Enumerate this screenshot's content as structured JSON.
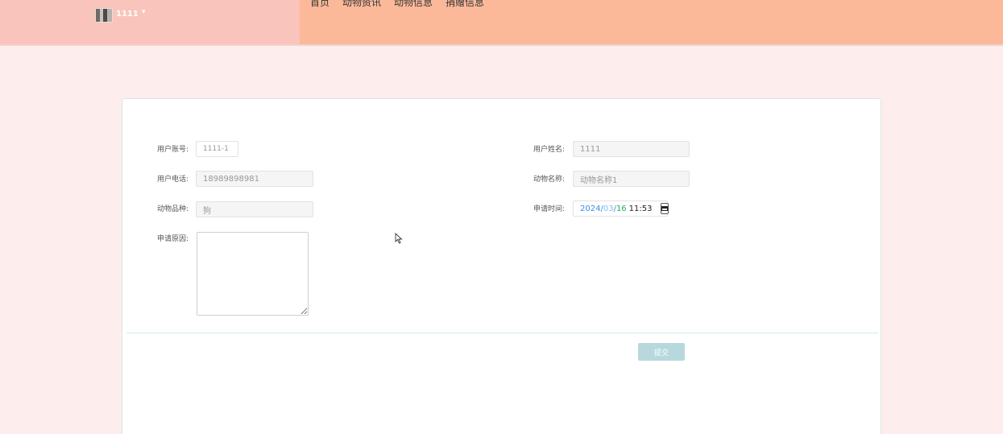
{
  "header": {
    "username": "1111",
    "caret": "▾",
    "nav": [
      "首页",
      "动物资讯",
      "动物信息",
      "捐赠信息"
    ]
  },
  "form": {
    "account_label": "用户账号:",
    "account_value": "1111-1",
    "name_label": "用户姓名:",
    "name_value": "1111",
    "phone_label": "用户电话:",
    "phone_value": "18989898981",
    "animal_name_label": "动物名称:",
    "animal_name_value": "动物名称1",
    "breed_label": "动物品种:",
    "breed_value": "狗",
    "time_label": "申请时间:",
    "date_year": "2024",
    "date_month": "03",
    "date_day": "16",
    "date_time": "11:53",
    "reason_label": "申请原因:",
    "reason_value": "",
    "submit_label": "提交"
  },
  "colors": {
    "header_left": "#f9c4bc",
    "header_right": "#fbb99a",
    "page_bg": "#fdeeed",
    "submit_bg": "#b7d9dd"
  }
}
